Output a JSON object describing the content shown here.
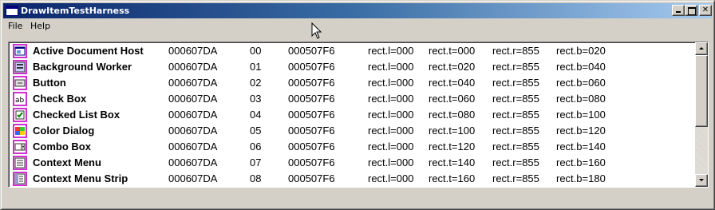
{
  "window": {
    "title": "DrawItemTestHarness",
    "minimize_icon": "minimize-icon",
    "maximize_icon": "maximize-icon",
    "close_symbol": "✕"
  },
  "menu": {
    "file": "File",
    "help": "Help"
  },
  "list": {
    "items": [
      {
        "name": "Active Document Host",
        "handle": "000607DA",
        "index": "00",
        "hdc": "000507F6",
        "l": "rect.l=000",
        "t": "rect.t=000",
        "r": "rect.r=855",
        "b": "rect.b=020",
        "icon": "document-host-icon"
      },
      {
        "name": "Background Worker",
        "handle": "000607DA",
        "index": "01",
        "hdc": "000507F6",
        "l": "rect.l=000",
        "t": "rect.t=020",
        "r": "rect.r=855",
        "b": "rect.b=040",
        "icon": "background-worker-icon"
      },
      {
        "name": "Button",
        "handle": "000607DA",
        "index": "02",
        "hdc": "000507F6",
        "l": "rect.l=000",
        "t": "rect.t=040",
        "r": "rect.r=855",
        "b": "rect.b=060",
        "icon": "button-icon"
      },
      {
        "name": "Check Box",
        "handle": "000607DA",
        "index": "03",
        "hdc": "000507F6",
        "l": "rect.l=000",
        "t": "rect.t=060",
        "r": "rect.r=855",
        "b": "rect.b=080",
        "icon": "checkbox-icon"
      },
      {
        "name": "Checked List Box",
        "handle": "000607DA",
        "index": "04",
        "hdc": "000507F6",
        "l": "rect.l=000",
        "t": "rect.t=080",
        "r": "rect.r=855",
        "b": "rect.b=100",
        "icon": "checked-list-icon"
      },
      {
        "name": "Color Dialog",
        "handle": "000607DA",
        "index": "05",
        "hdc": "000507F6",
        "l": "rect.l=000",
        "t": "rect.t=100",
        "r": "rect.r=855",
        "b": "rect.b=120",
        "icon": "color-dialog-icon"
      },
      {
        "name": "Combo Box",
        "handle": "000607DA",
        "index": "06",
        "hdc": "000507F6",
        "l": "rect.l=000",
        "t": "rect.t=120",
        "r": "rect.r=855",
        "b": "rect.b=140",
        "icon": "combo-box-icon"
      },
      {
        "name": "Context Menu",
        "handle": "000607DA",
        "index": "07",
        "hdc": "000507F6",
        "l": "rect.l=000",
        "t": "rect.t=140",
        "r": "rect.r=855",
        "b": "rect.b=160",
        "icon": "context-menu-icon"
      },
      {
        "name": "Context Menu Strip",
        "handle": "000607DA",
        "index": "08",
        "hdc": "000507F6",
        "l": "rect.l=000",
        "t": "rect.t=160",
        "r": "rect.r=855",
        "b": "rect.b=180",
        "icon": "context-menu-strip-icon"
      }
    ]
  },
  "colors": {
    "title_gradient_start": "#0a246a",
    "title_gradient_end": "#a6caf0",
    "icon_border": "#cc33cc",
    "face": "#d4d0c8"
  }
}
